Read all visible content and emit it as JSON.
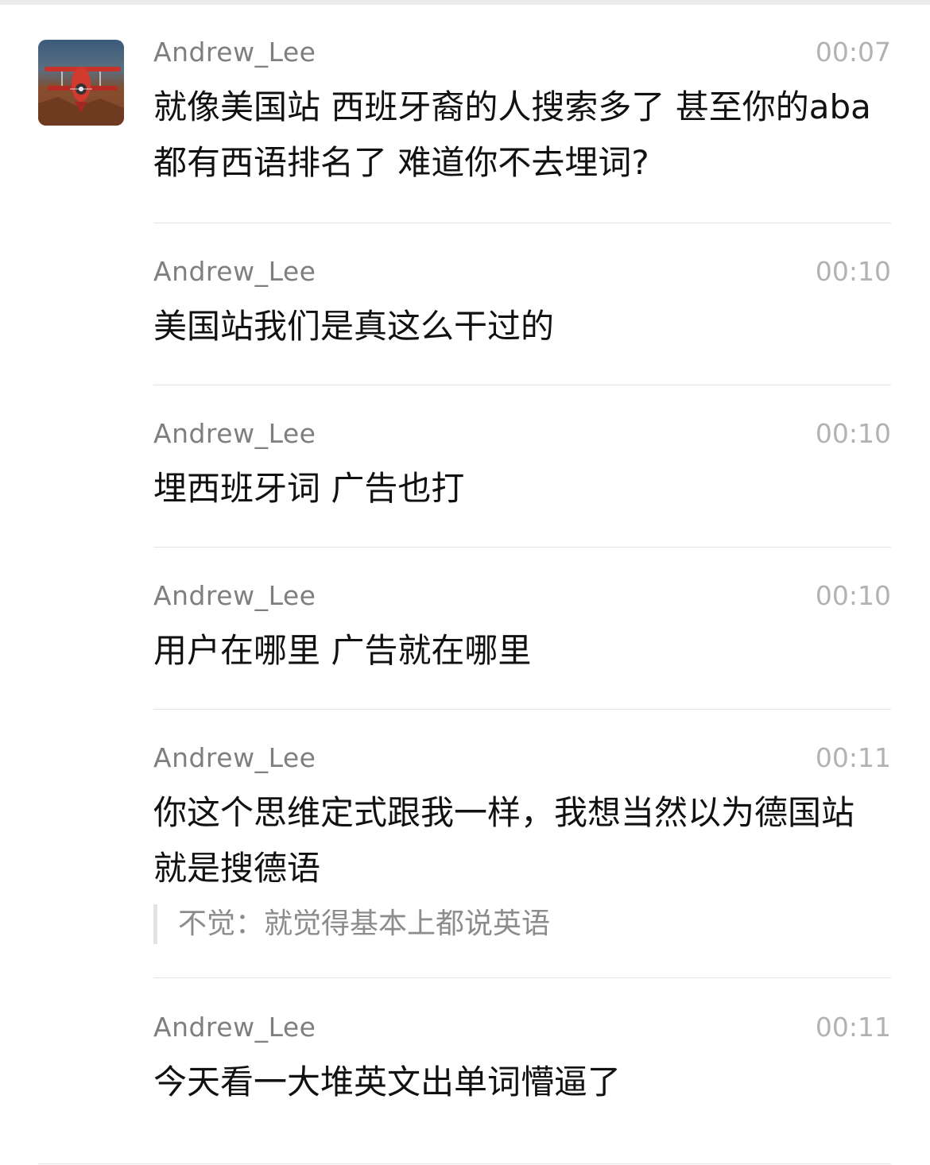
{
  "avatar": {
    "icon": "biplane-avatar-icon"
  },
  "messages": [
    {
      "sender": "Andrew_Lee",
      "time": "00:07",
      "text": "就像美国站 西班牙裔的人搜索多了  甚至你的aba都有西语排名了  难道你不去埋词?"
    },
    {
      "sender": "Andrew_Lee",
      "time": "00:10",
      "text": "美国站我们是真这么干过的"
    },
    {
      "sender": "Andrew_Lee",
      "time": "00:10",
      "text": "埋西班牙词  广告也打"
    },
    {
      "sender": "Andrew_Lee",
      "time": "00:10",
      "text": "用户在哪里  广告就在哪里"
    },
    {
      "sender": "Andrew_Lee",
      "time": "00:11",
      "text": "你这个思维定式跟我一样，我想当然以为德国站就是搜德语",
      "quote": "不觉：就觉得基本上都说英语"
    },
    {
      "sender": "Andrew_Lee",
      "time": "00:11",
      "text": "今天看一大堆英文出单词懵逼了"
    }
  ]
}
